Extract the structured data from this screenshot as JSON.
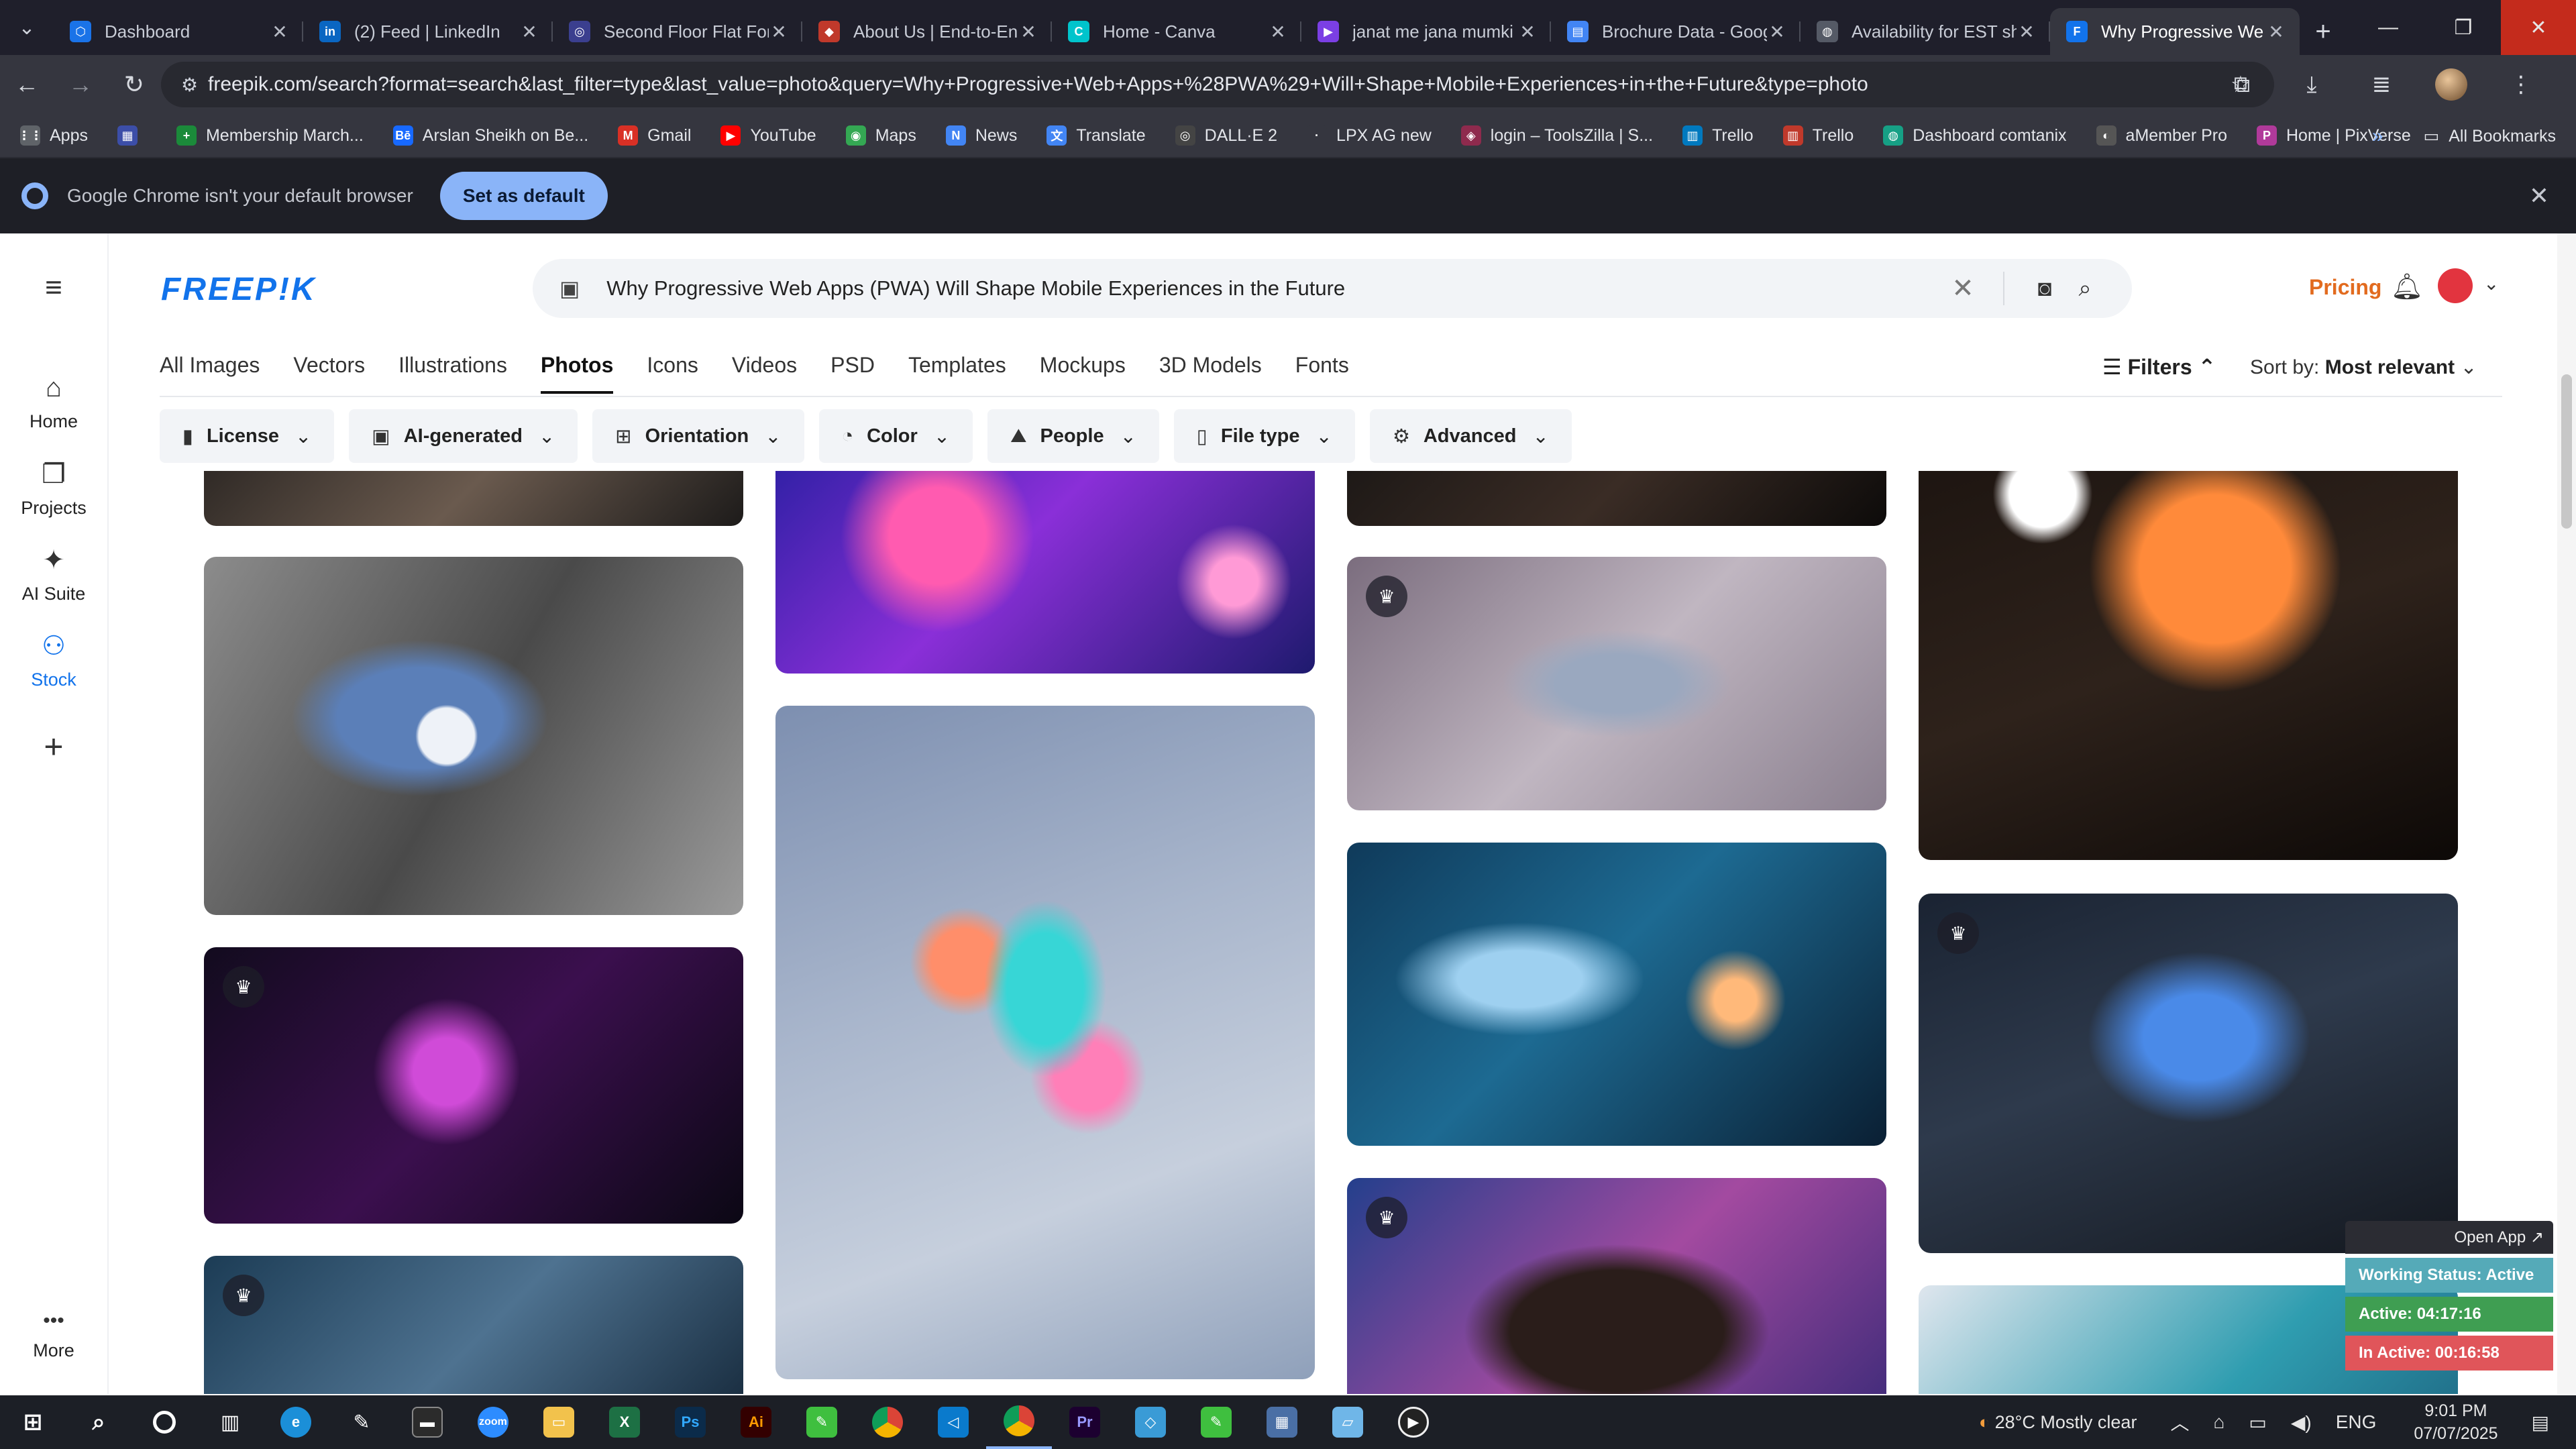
{
  "browser": {
    "tabs": [
      {
        "label": "Dashboard",
        "icon": "dashboard-icon",
        "color": "#1a73e8",
        "glyph": "⬡"
      },
      {
        "label": "(2) Feed | LinkedIn",
        "icon": "linkedin-icon",
        "color": "#0a66c2",
        "glyph": "in"
      },
      {
        "label": "Second Floor Flat For",
        "icon": "site-icon",
        "color": "#3b3f8f",
        "glyph": "◎"
      },
      {
        "label": "About Us | End-to-En",
        "icon": "diamond-icon",
        "color": "#c0392b",
        "glyph": "◆"
      },
      {
        "label": "Home - Canva",
        "icon": "canva-icon",
        "color": "#00c4cc",
        "glyph": "C"
      },
      {
        "label": "janat me jana mumki",
        "icon": "video-icon",
        "color": "#7b3fe4",
        "glyph": "▶"
      },
      {
        "label": "Brochure Data - Goog",
        "icon": "docs-icon",
        "color": "#4285f4",
        "glyph": "▤"
      },
      {
        "label": "Availability for EST sh",
        "icon": "globe-icon",
        "color": "#555a66",
        "glyph": "◍"
      },
      {
        "label": "Why Progressive We",
        "icon": "freepik-tab-icon",
        "color": "#1273eb",
        "glyph": "F"
      }
    ],
    "url": "freepik.com/search?format=search&last_filter=type&last_value=photo&query=Why+Progressive+Web+Apps+%28PWA%29+Will+Shape+Mobile+Experiences+in+the+Future&type=photo",
    "bookmarks": [
      {
        "label": "Apps",
        "color": "#5f6368",
        "glyph": "⋮⋮"
      },
      {
        "label": "",
        "color": "#3c4ea8",
        "glyph": "▦"
      },
      {
        "label": "Membership March...",
        "color": "#1b8a3a",
        "glyph": "+"
      },
      {
        "label": "Arslan Sheikh on Be...",
        "color": "#1769ff",
        "glyph": "Bē"
      },
      {
        "label": "Gmail",
        "color": "#d93025",
        "glyph": "M"
      },
      {
        "label": "YouTube",
        "color": "#ff0000",
        "glyph": "▶"
      },
      {
        "label": "Maps",
        "color": "#34a853",
        "glyph": "◉"
      },
      {
        "label": "News",
        "color": "#4285f4",
        "glyph": "N"
      },
      {
        "label": "Translate",
        "color": "#4285f4",
        "glyph": "文"
      },
      {
        "label": "DALL·E 2",
        "color": "#444",
        "glyph": "◎"
      },
      {
        "label": "LPX AG new",
        "color": "#35363f",
        "glyph": "·"
      },
      {
        "label": "login – ToolsZilla | S...",
        "color": "#8e2a4d",
        "glyph": "◈"
      },
      {
        "label": "Trello",
        "color": "#0079bf",
        "glyph": "▥"
      },
      {
        "label": "Trello",
        "color": "#c0392b",
        "glyph": "▥"
      },
      {
        "label": "Dashboard comtanix",
        "color": "#16a085",
        "glyph": "◍"
      },
      {
        "label": "aMember Pro",
        "color": "#555",
        "glyph": "◐"
      },
      {
        "label": "Home | PixVerse",
        "color": "#b03a9a",
        "glyph": "P"
      }
    ],
    "all_bookmarks": "All Bookmarks"
  },
  "infobar": {
    "message": "Google Chrome isn't your default browser",
    "button": "Set as default"
  },
  "leftnav": [
    {
      "label": "Home",
      "icon": "home-icon",
      "glyph": "⌂"
    },
    {
      "label": "Projects",
      "icon": "projects-icon",
      "glyph": "❐"
    },
    {
      "label": "AI Suite",
      "icon": "sparkle-icon",
      "glyph": "✦"
    },
    {
      "label": "Stock",
      "icon": "stock-icon",
      "glyph": "⚇"
    },
    {
      "label": "",
      "icon": "plus-icon",
      "glyph": "+"
    },
    {
      "label": "More",
      "icon": "more-icon",
      "glyph": "•••"
    }
  ],
  "header": {
    "logo": "FREEP!K",
    "search_query": "Why Progressive Web Apps (PWA) Will Shape Mobile Experiences in the Future",
    "pricing": "Pricing"
  },
  "tabs": [
    "All Images",
    "Vectors",
    "Illustrations",
    "Photos",
    "Icons",
    "Videos",
    "PSD",
    "Templates",
    "Mockups",
    "3D Models",
    "Fonts"
  ],
  "active_tab": "Photos",
  "filters_label": "Filters",
  "sort": {
    "label": "Sort by:",
    "value": "Most relevant"
  },
  "chips": [
    {
      "label": "License",
      "icon": "license-icon",
      "glyph": "▮"
    },
    {
      "label": "AI-generated",
      "icon": "ai-icon",
      "glyph": "▣"
    },
    {
      "label": "Orientation",
      "icon": "orientation-icon",
      "glyph": "⊞"
    },
    {
      "label": "Color",
      "icon": "palette-icon",
      "glyph": "◔"
    },
    {
      "label": "People",
      "icon": "people-icon",
      "glyph": "⛰"
    },
    {
      "label": "File type",
      "icon": "file-icon",
      "glyph": "▯"
    },
    {
      "label": "Advanced",
      "icon": "gear-icon",
      "glyph": "⚙"
    }
  ],
  "widget": {
    "open": "Open App ↗",
    "working": "Working Status: Active",
    "active": "Active: 04:17:16",
    "inactive": "In Active: 00:16:58"
  },
  "taskbar": {
    "weather": "28°C  Mostly clear",
    "lang": "ENG",
    "time": "9:01 PM",
    "date": "07/07/2025"
  }
}
